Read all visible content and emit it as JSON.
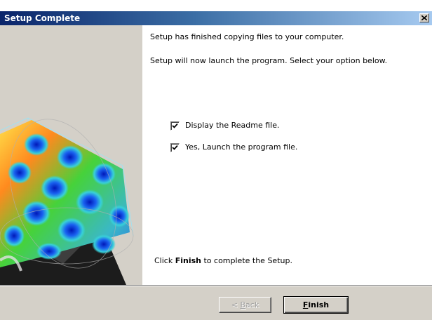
{
  "window": {
    "title": "Setup Complete",
    "close_glyph": "×"
  },
  "content": {
    "line1": "Setup has finished copying files to your computer.",
    "line2": "Setup will now launch the program. Select your option below.",
    "options": [
      {
        "label": "Display the Readme file.",
        "checked": true
      },
      {
        "label": "Yes, Launch the program file.",
        "checked": true
      }
    ],
    "finish_hint_prefix": "Click",
    "finish_hint_bold": "Finish",
    "finish_hint_suffix": "to complete the Setup."
  },
  "footer": {
    "back_label_prefix": "< ",
    "back_label_mnemonic": "B",
    "back_label_rest": "ack",
    "finish_label_mnemonic": "F",
    "finish_label_rest": "inish"
  },
  "colors": {
    "titlebar_start": "#0a246a",
    "titlebar_end": "#a6caf0",
    "dialog_face": "#d4d0c8"
  },
  "icons": {
    "close": "close-icon",
    "check": "checkmark-icon",
    "sidebar_art": "3d-surface-plot-graphic"
  }
}
